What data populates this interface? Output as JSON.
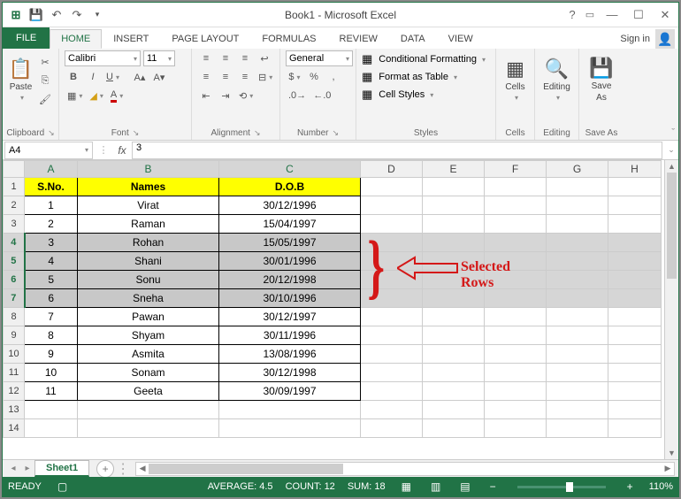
{
  "title": "Book1 - Microsoft Excel",
  "signin": "Sign in",
  "tabs": {
    "file": "FILE",
    "home": "HOME",
    "insert": "INSERT",
    "page": "PAGE LAYOUT",
    "formulas": "FORMULAS",
    "review": "REVIEW",
    "data": "DATA",
    "view": "VIEW"
  },
  "ribbon": {
    "clipboard": {
      "paste": "Paste",
      "label": "Clipboard"
    },
    "font": {
      "name": "Calibri",
      "size": "11",
      "label": "Font"
    },
    "alignment": {
      "label": "Alignment"
    },
    "number": {
      "format": "General",
      "label": "Number"
    },
    "styles": {
      "cond": "Conditional Formatting",
      "table": "Format as Table",
      "cell": "Cell Styles",
      "label": "Styles"
    },
    "cells": {
      "label": "Cells",
      "btn": "Cells"
    },
    "editing": {
      "label": "Editing",
      "btn": "Editing"
    },
    "saveas": {
      "btn1": "Save",
      "btn2": "As",
      "label": "Save As"
    }
  },
  "namebox": "A4",
  "formula": "3",
  "columns": [
    "A",
    "B",
    "C",
    "D",
    "E",
    "F",
    "G",
    "H"
  ],
  "headers": {
    "a": "S.No.",
    "b": "Names",
    "c": "D.O.B"
  },
  "rows": [
    {
      "n": "1",
      "name": "Virat",
      "dob": "30/12/1996"
    },
    {
      "n": "2",
      "name": "Raman",
      "dob": "15/04/1997"
    },
    {
      "n": "3",
      "name": "Rohan",
      "dob": "15/05/1997"
    },
    {
      "n": "4",
      "name": "Shani",
      "dob": "30/01/1996"
    },
    {
      "n": "5",
      "name": "Sonu",
      "dob": "20/12/1998"
    },
    {
      "n": "6",
      "name": "Sneha",
      "dob": "30/10/1996"
    },
    {
      "n": "7",
      "name": "Pawan",
      "dob": "30/12/1997"
    },
    {
      "n": "8",
      "name": "Shyam",
      "dob": "30/11/1996"
    },
    {
      "n": "9",
      "name": "Asmita",
      "dob": "13/08/1996"
    },
    {
      "n": "10",
      "name": "Sonam",
      "dob": "30/12/1998"
    },
    {
      "n": "11",
      "name": "Geeta",
      "dob": "30/09/1997"
    }
  ],
  "annotation": "Selected Rows",
  "sheet": "Sheet1",
  "status": {
    "ready": "READY",
    "avg": "AVERAGE: 4.5",
    "count": "COUNT: 12",
    "sum": "SUM: 18",
    "zoom": "110%"
  }
}
